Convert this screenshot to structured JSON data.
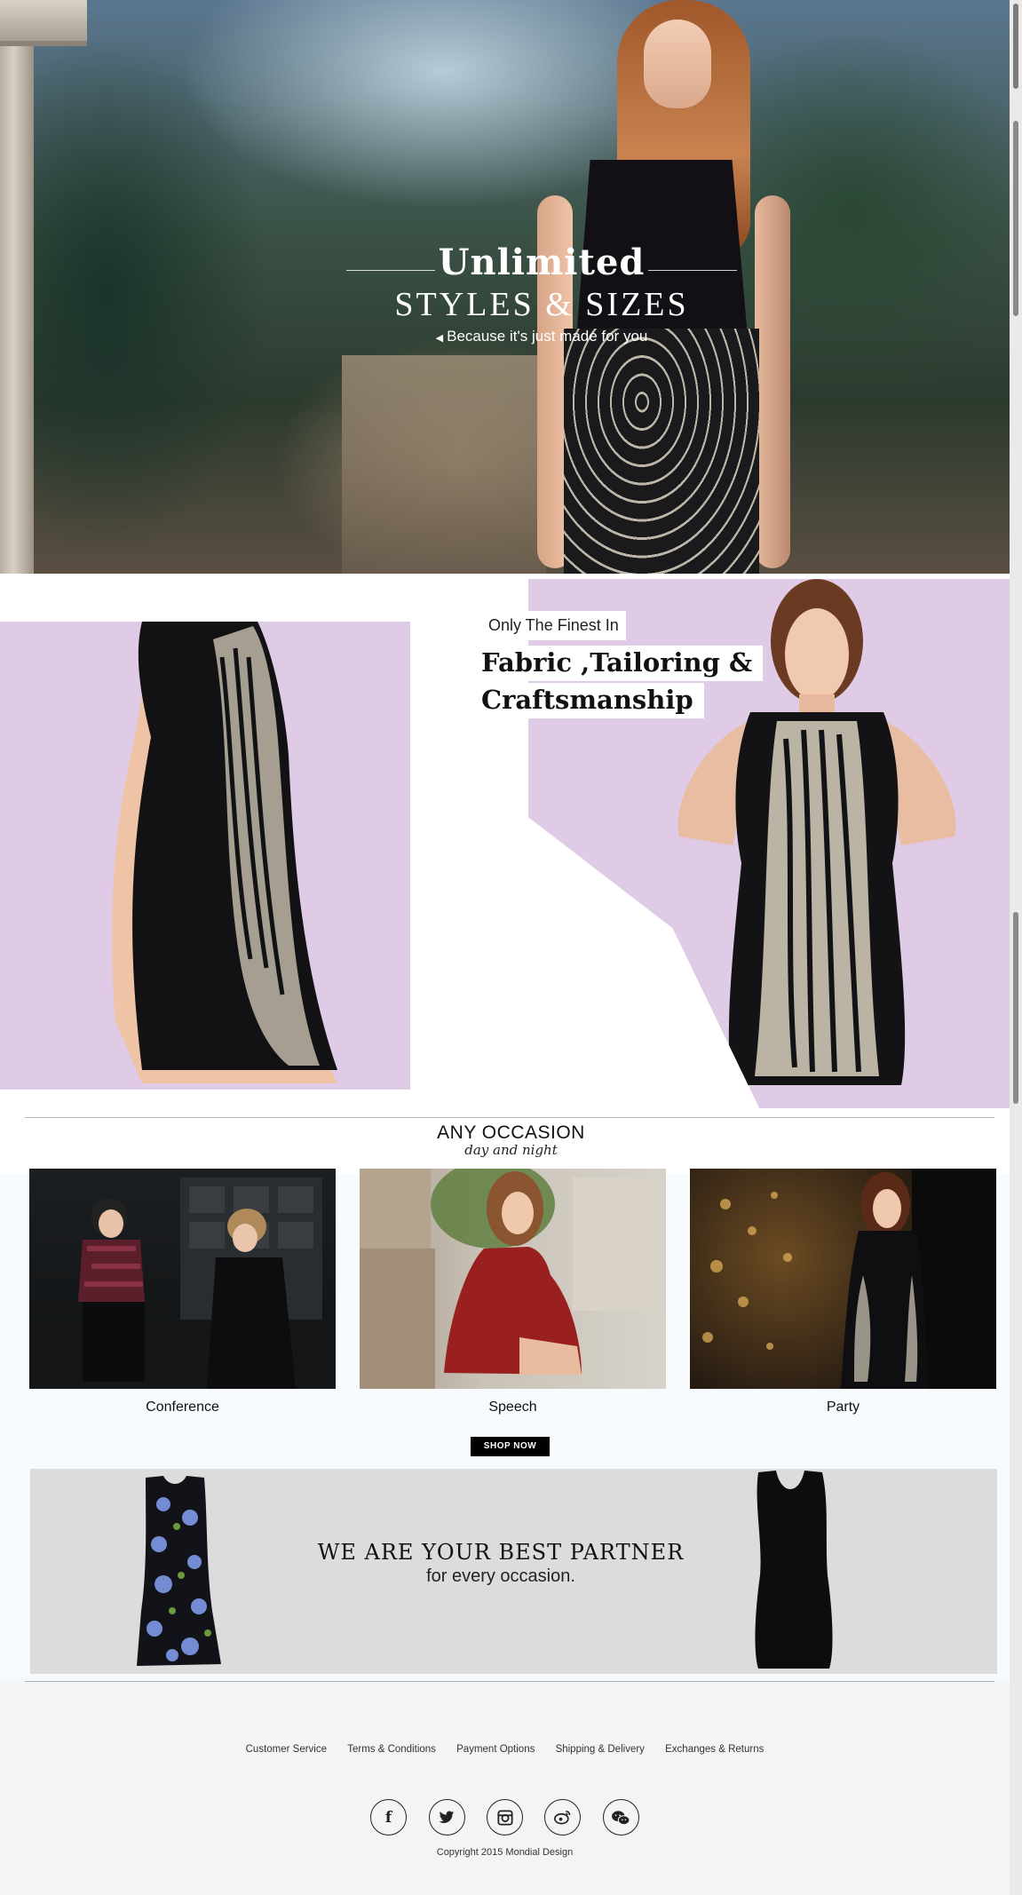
{
  "hero": {
    "title": "Unlimited",
    "subtitle": "STYLES & SIZES",
    "tagline": "Because it's just made for you"
  },
  "feature": {
    "eyebrow": "Only The Finest In",
    "heading_line1": "Fabric ,Tailoring &",
    "heading_line2": "Craftsmanship"
  },
  "occasions": {
    "title": "ANY OCCASION",
    "subtitle": "day and night",
    "cards": [
      {
        "label": "Conference"
      },
      {
        "label": "Speech"
      },
      {
        "label": "Party"
      }
    ],
    "shop_now": "SHOP NOW"
  },
  "partner": {
    "title": "WE ARE YOUR BEST PARTNER",
    "subtitle": "for every occasion."
  },
  "footer": {
    "links": [
      "Customer Service",
      "Terms & Conditions",
      "Payment Options",
      "Shipping & Delivery",
      "Exchanges & Returns"
    ],
    "social": [
      {
        "icon": "facebook-icon",
        "glyph": "f"
      },
      {
        "icon": "twitter-icon",
        "glyph": "t"
      },
      {
        "icon": "instagram-icon",
        "glyph": "◙"
      },
      {
        "icon": "weibo-icon",
        "glyph": "◉"
      },
      {
        "icon": "wechat-icon",
        "glyph": "◎"
      }
    ],
    "copyright": "Copyright 2015 Mondial Design"
  },
  "colors": {
    "lilac": "#dfcbe5",
    "banner_gray": "#dcdcdc",
    "button": "#000000"
  }
}
